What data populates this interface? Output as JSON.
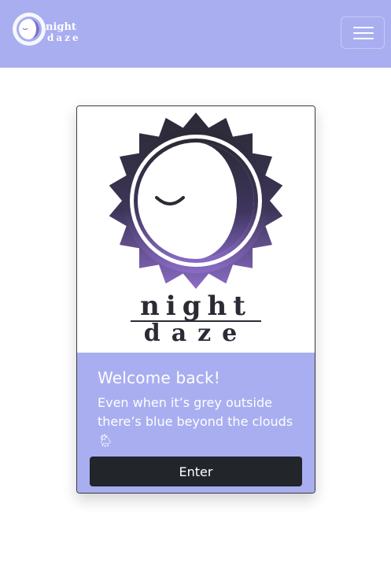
{
  "brand": {
    "logo_line1": "night",
    "logo_line2": "daze"
  },
  "nav": {
    "toggle_icon": "hamburger-icon"
  },
  "card": {
    "logo_line1": "night",
    "logo_line2": "daze",
    "title": "Welcome back!",
    "text": "Even when it’s grey outside there’s blue beyond the clouds 🌦",
    "button_label": "Enter"
  },
  "colors": {
    "navbar": "#a8aef0",
    "card_body": "#a8aef0",
    "button": "#22252a",
    "logo_dark": "#2b2a35",
    "logo_purple": "#6e4fa2"
  }
}
